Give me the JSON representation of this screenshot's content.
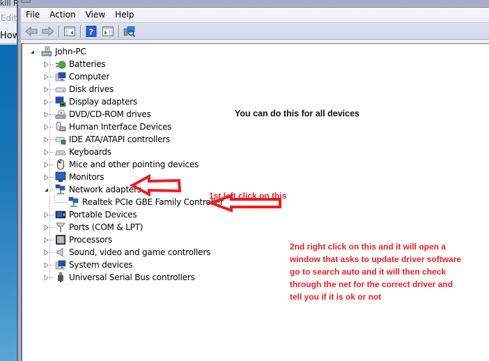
{
  "background_window": {
    "title_fragment": "kill Ri",
    "menu_fragment": "Edit",
    "content_fragment": "How"
  },
  "window": {
    "menu": [
      "File",
      "Action",
      "View",
      "Help"
    ],
    "toolbar": [
      {
        "icon": "back-arrow-icon",
        "label": "Back"
      },
      {
        "icon": "forward-arrow-icon",
        "label": "Forward"
      },
      {
        "icon": "show-hide-console-tree-icon",
        "label": "Show/Hide Console Tree"
      },
      {
        "icon": "help-icon",
        "label": "Help"
      },
      {
        "icon": "show-hide-action-pane-icon",
        "label": "Show/Hide Action Pane"
      },
      {
        "icon": "scan-hardware-changes-icon",
        "label": "Scan for hardware changes"
      }
    ]
  },
  "tree": {
    "root": {
      "label": "John-PC",
      "icon": "computer-root-icon",
      "expanded": true
    },
    "categories": [
      {
        "label": "Batteries",
        "icon": "battery-icon",
        "expanded": false
      },
      {
        "label": "Computer",
        "icon": "computer-icon",
        "expanded": false
      },
      {
        "label": "Disk drives",
        "icon": "disk-drive-icon",
        "expanded": false
      },
      {
        "label": "Display adapters",
        "icon": "display-adapter-icon",
        "expanded": false
      },
      {
        "label": "DVD/CD-ROM drives",
        "icon": "dvd-drive-icon",
        "expanded": false
      },
      {
        "label": "Human Interface Devices",
        "icon": "hid-icon",
        "expanded": false
      },
      {
        "label": "IDE ATA/ATAPI controllers",
        "icon": "ide-controller-icon",
        "expanded": false
      },
      {
        "label": "Keyboards",
        "icon": "keyboard-icon",
        "expanded": false
      },
      {
        "label": "Mice and other pointing devices",
        "icon": "mouse-icon",
        "expanded": false
      },
      {
        "label": "Monitors",
        "icon": "monitor-icon",
        "expanded": false
      },
      {
        "label": "Network adapters",
        "icon": "network-adapter-icon",
        "expanded": true,
        "children": [
          {
            "label": "Realtek PCIe GBE Family Controller",
            "icon": "network-adapter-icon"
          }
        ]
      },
      {
        "label": "Portable Devices",
        "icon": "portable-device-icon",
        "expanded": false
      },
      {
        "label": "Ports (COM & LPT)",
        "icon": "port-icon",
        "expanded": false
      },
      {
        "label": "Processors",
        "icon": "processor-icon",
        "expanded": false
      },
      {
        "label": "Sound, video and game controllers",
        "icon": "sound-icon",
        "expanded": false
      },
      {
        "label": "System devices",
        "icon": "system-device-icon",
        "expanded": false
      },
      {
        "label": "Universal Serial Bus controllers",
        "icon": "usb-icon",
        "expanded": false
      }
    ]
  },
  "annotations": {
    "all_devices": "You can do this for all devices",
    "first_step": "1st left click on this",
    "second_step": "2nd right click on this and it will open a window that asks to update driver software go to search auto and it will then check through the net for the correct driver and tell you if it is ok or not"
  },
  "colors": {
    "annotation_red": "#ee1c24",
    "annotation_black": "#111111",
    "arrow_red": "#ee1c24"
  }
}
